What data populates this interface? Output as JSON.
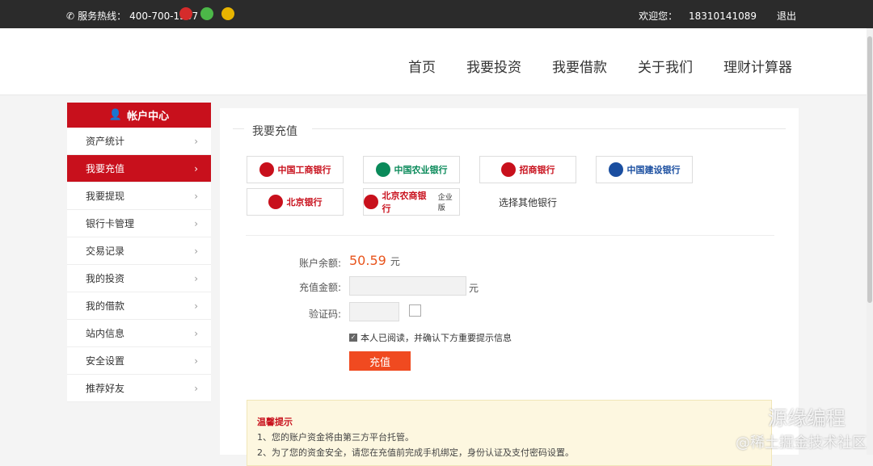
{
  "topbar": {
    "hotline_label": "服务热线：",
    "hotline": "400-700-1307",
    "welcome": "欢迎您：",
    "username": "18310141089",
    "logout": "退出"
  },
  "nav": [
    "首页",
    "我要投资",
    "我要借款",
    "关于我们",
    "理财计算器"
  ],
  "sidebar": {
    "title": "帐户中心",
    "items": [
      "资产统计",
      "我要充值",
      "我要提现",
      "银行卡管理",
      "交易记录",
      "我的投资",
      "我的借款",
      "站内信息",
      "安全设置",
      "推荐好友"
    ],
    "active_index": 1
  },
  "main": {
    "section_title": "我要充值",
    "banks": [
      {
        "name": "中国工商银行",
        "color": "#c8101c"
      },
      {
        "name": "中国农业银行",
        "color": "#0a8a5a"
      },
      {
        "name": "招商银行",
        "color": "#c8101c"
      },
      {
        "name": "中国建设银行",
        "color": "#1a4ea0"
      },
      {
        "name": "北京银行",
        "color": "#c8101c"
      },
      {
        "name": "北京农商银行",
        "sub": "企业版",
        "color": "#c8101c"
      }
    ],
    "other_bank": "选择其他银行",
    "form": {
      "balance_label": "账户余额:",
      "balance_value": "50.59",
      "balance_unit": "元",
      "amount_label": "充值金额:",
      "amount_unit": "元",
      "captcha_label": "验证码:",
      "agree_text": "本人已阅读，并确认下方重要提示信息",
      "submit_label": "充值"
    },
    "tips": {
      "title": "温馨提示",
      "line1": "1、您的账户资金将由第三方平台托管。",
      "line2": "2、为了您的资金安全，请您在充值前完成手机绑定，身份认证及支付密码设置。"
    }
  },
  "watermark": {
    "main": "源缘编程",
    "sub": "@稀土掘金技术社区"
  }
}
